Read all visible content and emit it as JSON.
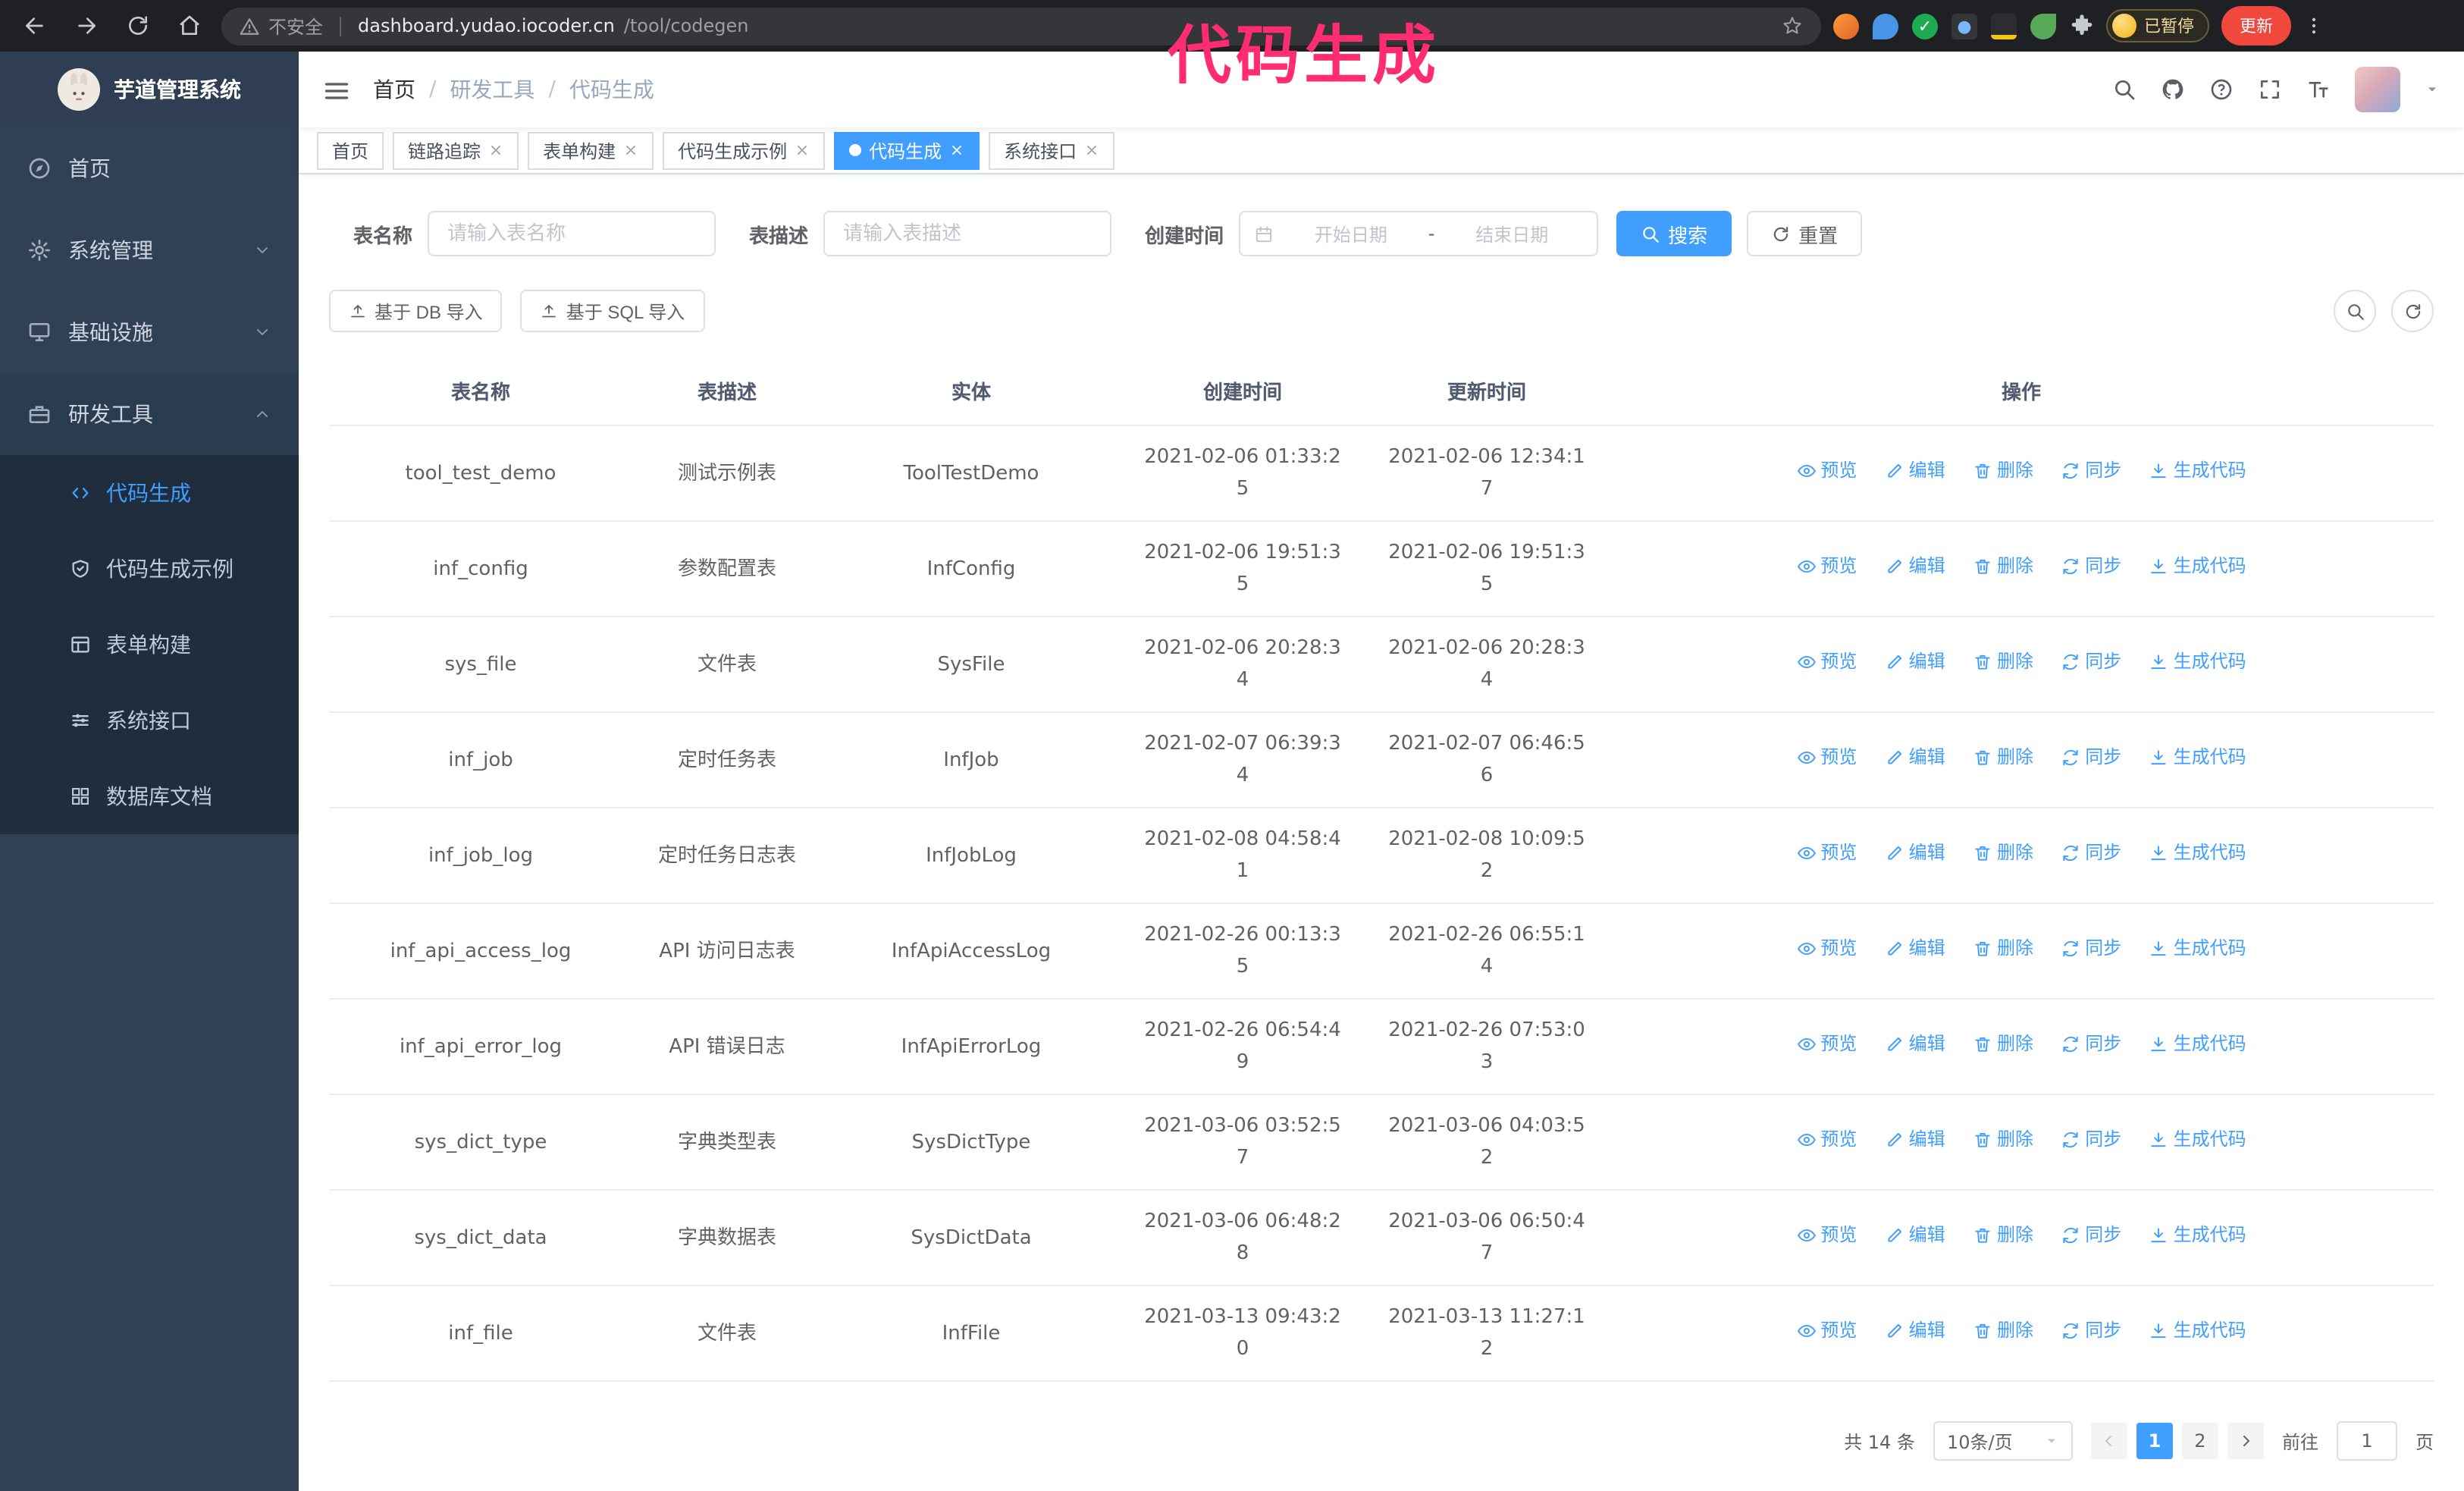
{
  "annotation": "代码生成",
  "browser": {
    "security_chip": "不安全",
    "url_host": "dashboard.yudao.iocoder.cn",
    "url_path": "/tool/codegen",
    "paused_badge": "已暂停",
    "update_button": "更新"
  },
  "sidebar": {
    "logo_title": "芋道管理系统",
    "items": [
      {
        "label": "首页"
      },
      {
        "label": "系统管理",
        "expandable": true
      },
      {
        "label": "基础设施",
        "expandable": true
      },
      {
        "label": "研发工具",
        "expandable": true,
        "expanded": true
      }
    ],
    "subitems": [
      {
        "label": "代码生成",
        "active": true
      },
      {
        "label": "代码生成示例"
      },
      {
        "label": "表单构建"
      },
      {
        "label": "系统接口"
      },
      {
        "label": "数据库文档"
      }
    ]
  },
  "breadcrumb": [
    "首页",
    "研发工具",
    "代码生成"
  ],
  "tabs": [
    {
      "label": "首页",
      "closable": false,
      "active": false
    },
    {
      "label": "链路追踪",
      "closable": true,
      "active": false
    },
    {
      "label": "表单构建",
      "closable": true,
      "active": false
    },
    {
      "label": "代码生成示例",
      "closable": true,
      "active": false
    },
    {
      "label": "代码生成",
      "closable": true,
      "active": true
    },
    {
      "label": "系统接口",
      "closable": true,
      "active": false
    }
  ],
  "filters": {
    "table_name_label": "表名称",
    "table_name_placeholder": "请输入表名称",
    "table_desc_label": "表描述",
    "table_desc_placeholder": "请输入表描述",
    "create_time_label": "创建时间",
    "date_start_placeholder": "开始日期",
    "date_separator": "-",
    "date_end_placeholder": "结束日期",
    "search_button": "搜索",
    "reset_button": "重置"
  },
  "toolbar": {
    "import_db_button": "基于 DB 导入",
    "import_sql_button": "基于 SQL 导入"
  },
  "table": {
    "columns": [
      "表名称",
      "表描述",
      "实体",
      "创建时间",
      "更新时间",
      "操作"
    ],
    "actions": [
      "预览",
      "编辑",
      "删除",
      "同步",
      "生成代码"
    ],
    "rows": [
      {
        "name": "tool_test_demo",
        "desc": "测试示例表",
        "entity": "ToolTestDemo",
        "created": "2021-02-06 01:33:25",
        "updated": "2021-02-06 12:34:17"
      },
      {
        "name": "inf_config",
        "desc": "参数配置表",
        "entity": "InfConfig",
        "created": "2021-02-06 19:51:35",
        "updated": "2021-02-06 19:51:35"
      },
      {
        "name": "sys_file",
        "desc": "文件表",
        "entity": "SysFile",
        "created": "2021-02-06 20:28:34",
        "updated": "2021-02-06 20:28:34"
      },
      {
        "name": "inf_job",
        "desc": "定时任务表",
        "entity": "InfJob",
        "created": "2021-02-07 06:39:34",
        "updated": "2021-02-07 06:46:56"
      },
      {
        "name": "inf_job_log",
        "desc": "定时任务日志表",
        "entity": "InfJobLog",
        "created": "2021-02-08 04:58:41",
        "updated": "2021-02-08 10:09:52"
      },
      {
        "name": "inf_api_access_log",
        "desc": "API 访问日志表",
        "entity": "InfApiAccessLog",
        "created": "2021-02-26 00:13:35",
        "updated": "2021-02-26 06:55:14"
      },
      {
        "name": "inf_api_error_log",
        "desc": "API 错误日志",
        "entity": "InfApiErrorLog",
        "created": "2021-02-26 06:54:49",
        "updated": "2021-02-26 07:53:03"
      },
      {
        "name": "sys_dict_type",
        "desc": "字典类型表",
        "entity": "SysDictType",
        "created": "2021-03-06 03:52:57",
        "updated": "2021-03-06 04:03:52"
      },
      {
        "name": "sys_dict_data",
        "desc": "字典数据表",
        "entity": "SysDictData",
        "created": "2021-03-06 06:48:28",
        "updated": "2021-03-06 06:50:47"
      },
      {
        "name": "inf_file",
        "desc": "文件表",
        "entity": "InfFile",
        "created": "2021-03-13 09:43:20",
        "updated": "2021-03-13 11:27:12"
      }
    ]
  },
  "pagination": {
    "total": "共 14 条",
    "page_size": "10条/页",
    "pages": [
      "1",
      "2"
    ],
    "active_page": "1",
    "goto_label": "前往",
    "goto_value": "1",
    "goto_unit": "页"
  },
  "colors": {
    "accent_blue": "#409eff",
    "sidebar_bg": "#304156",
    "submenu_bg": "#1f2d3d",
    "annotation_pink": "#ff2d6f",
    "update_button_red": "#f0483c",
    "tag_active": "#409eff"
  }
}
